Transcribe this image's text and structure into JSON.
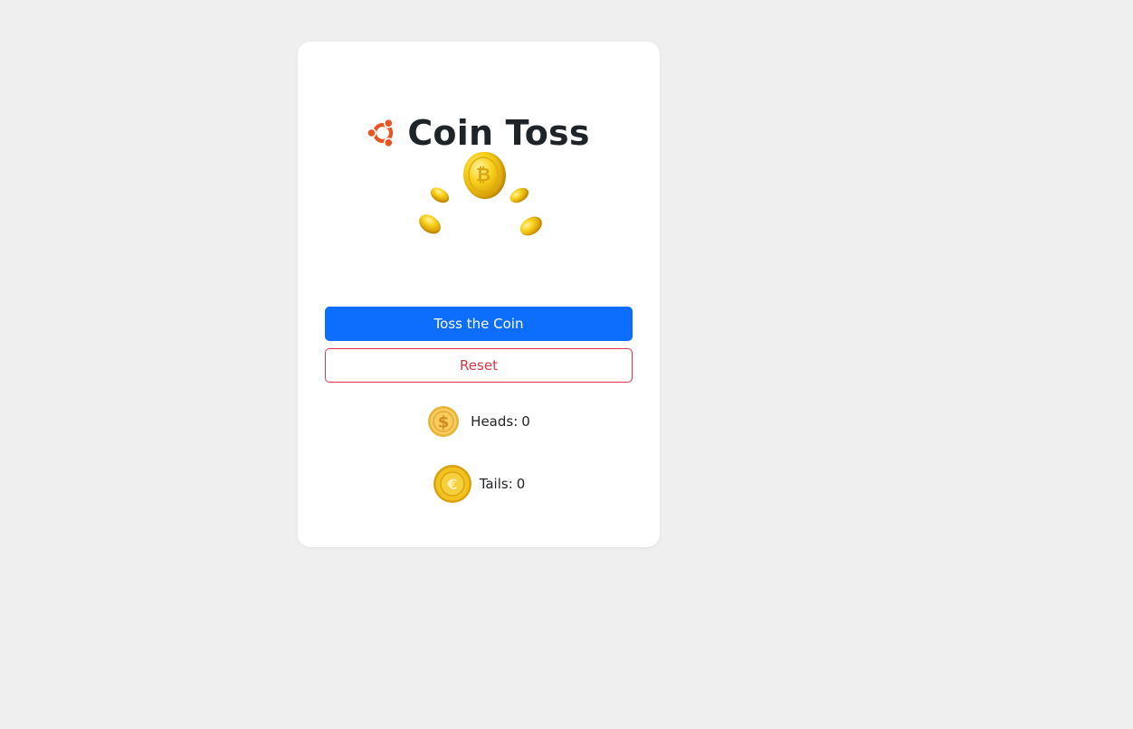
{
  "app": {
    "title": "Coin Toss",
    "logo_icon": "ubuntu-logo-icon",
    "logo_color": "#e95420"
  },
  "illustration": {
    "icon": "flying-coins-icon",
    "color": "#f5c518"
  },
  "buttons": {
    "toss_label": "Toss the Coin",
    "reset_label": "Reset",
    "primary_color": "#0d6efd",
    "danger_color": "#dc3545"
  },
  "stats": {
    "heads": {
      "icon": "dollar-coin-icon",
      "label": "Heads:",
      "count": "0"
    },
    "tails": {
      "icon": "euro-coin-icon",
      "label": "Tails:",
      "count": "0"
    }
  }
}
